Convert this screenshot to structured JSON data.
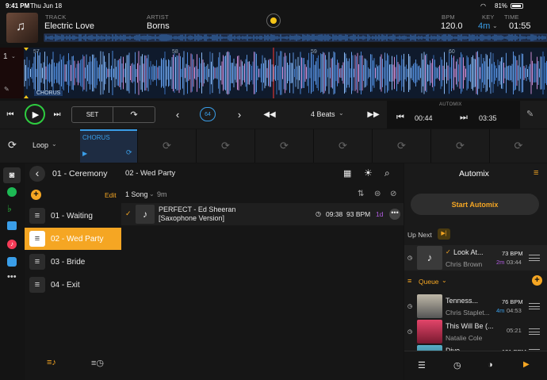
{
  "status": {
    "time": "9:41 PM",
    "date": "Thu Jun 18",
    "battery": "81%"
  },
  "deck": {
    "track_caption": "TRACK",
    "track": "Electric Love",
    "artist_caption": "ARTIST",
    "artist": "Borns",
    "bpm_caption": "BPM",
    "bpm": "120.0",
    "key_caption": "KEY",
    "key": "4m",
    "time_caption": "TIME",
    "time": "01:55",
    "deck_number": "1",
    "bar_markers": [
      "57",
      "58",
      "59",
      "60"
    ],
    "section_label": "CHORUS"
  },
  "transport": {
    "set_label": "SET",
    "loop_size": "64",
    "beats_label": "4 Beats",
    "automix_caption": "AUTOMIX",
    "elapsed": "00:44",
    "remaining": "03:35"
  },
  "pads": {
    "mode": "Loop",
    "cue_label": "CHORUS"
  },
  "playlists": {
    "header": "01 - Ceremony",
    "edit": "Edit",
    "items": [
      "01 - Waiting",
      "02 - Wed Party",
      "03 - Bride",
      "04 - Exit"
    ],
    "selected_index": 1
  },
  "content": {
    "title": "02 - Wed Party",
    "song_count": "1 Song",
    "duration": "9m",
    "songs": [
      {
        "title": "PERFECT - Ed Sheeran",
        "subtitle": "[Saxophone Version]",
        "time": "09:38",
        "bpm": "93 BPM",
        "key": "1d"
      }
    ]
  },
  "automix": {
    "title": "Automix",
    "start": "Start Automix",
    "upnext": "Up Next",
    "queue": "Queue",
    "next": {
      "title": "Look At...",
      "artist": "Chris Brown",
      "bpm": "73 BPM",
      "key": "2m",
      "time": "03:44"
    },
    "queue_items": [
      {
        "title": "Tenness...",
        "artist": "Chris Staplet...",
        "bpm": "76 BPM",
        "key": "4m",
        "time": "04:53"
      },
      {
        "title": "This Will Be (...",
        "artist": "Natalie Cole",
        "bpm": "",
        "key": "",
        "time": "05:21"
      },
      {
        "title": "Dive",
        "artist": "",
        "bpm": "131 BPM",
        "key": "",
        "time": ""
      }
    ]
  },
  "colors": {
    "accent": "#f5a623",
    "green": "#2ecc40",
    "blue": "#3a9ee8",
    "purple": "#b05ce0"
  }
}
